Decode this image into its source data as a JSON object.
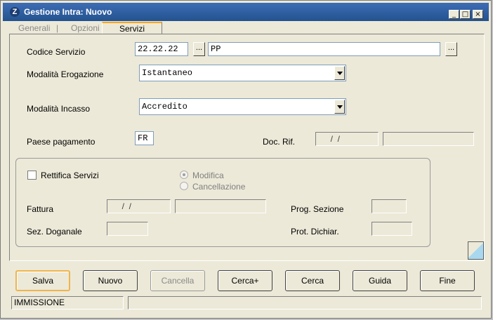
{
  "window": {
    "title": "Gestione Intra: Nuovo",
    "controls": [
      "_",
      "□",
      "×"
    ]
  },
  "tabs": [
    {
      "label": "Generali",
      "active": false
    },
    {
      "label": "Opzioni",
      "active": false
    },
    {
      "label": "Servizi",
      "active": true
    }
  ],
  "form": {
    "codice_servizio": {
      "label": "Codice Servizio",
      "code": "22.22.22",
      "desc": "PP",
      "btn": "..."
    },
    "modalita_erogazione": {
      "label": "Modalità Erogazione",
      "value": "Istantaneo"
    },
    "modalita_incasso": {
      "label": "Modalità Incasso",
      "value": "Accredito"
    },
    "paese_pagamento": {
      "label": "Paese pagamento",
      "value": "FR"
    },
    "doc_rif": {
      "label": "Doc. Rif.",
      "date": "  /  /",
      "value": ""
    }
  },
  "rettifica": {
    "checkbox_label": "Rettifica Servizi",
    "checked": false,
    "radio_modifica": "Modifica",
    "radio_cancellazione": "Cancellazione",
    "fattura": {
      "label": "Fattura",
      "date": "  /  /",
      "value": ""
    },
    "prog_sezione": {
      "label": "Prog. Sezione",
      "value": ""
    },
    "sez_doganale": {
      "label": "Sez. Doganale",
      "value": ""
    },
    "prot_dichiar": {
      "label": "Prot. Dichiar.",
      "value": ""
    }
  },
  "buttons": {
    "salva": "Salva",
    "nuovo": "Nuovo",
    "cancella": "Cancella",
    "cerca_plus": "Cerca+",
    "cerca": "Cerca",
    "guida": "Guida",
    "fine": "Fine"
  },
  "status": {
    "mode": "IMMISSIONE",
    "message": ""
  },
  "colors": {
    "titlebar": "#2a5a9c",
    "default_button_border": "#f0b44c",
    "active_tab_accent": "#f5a623"
  }
}
